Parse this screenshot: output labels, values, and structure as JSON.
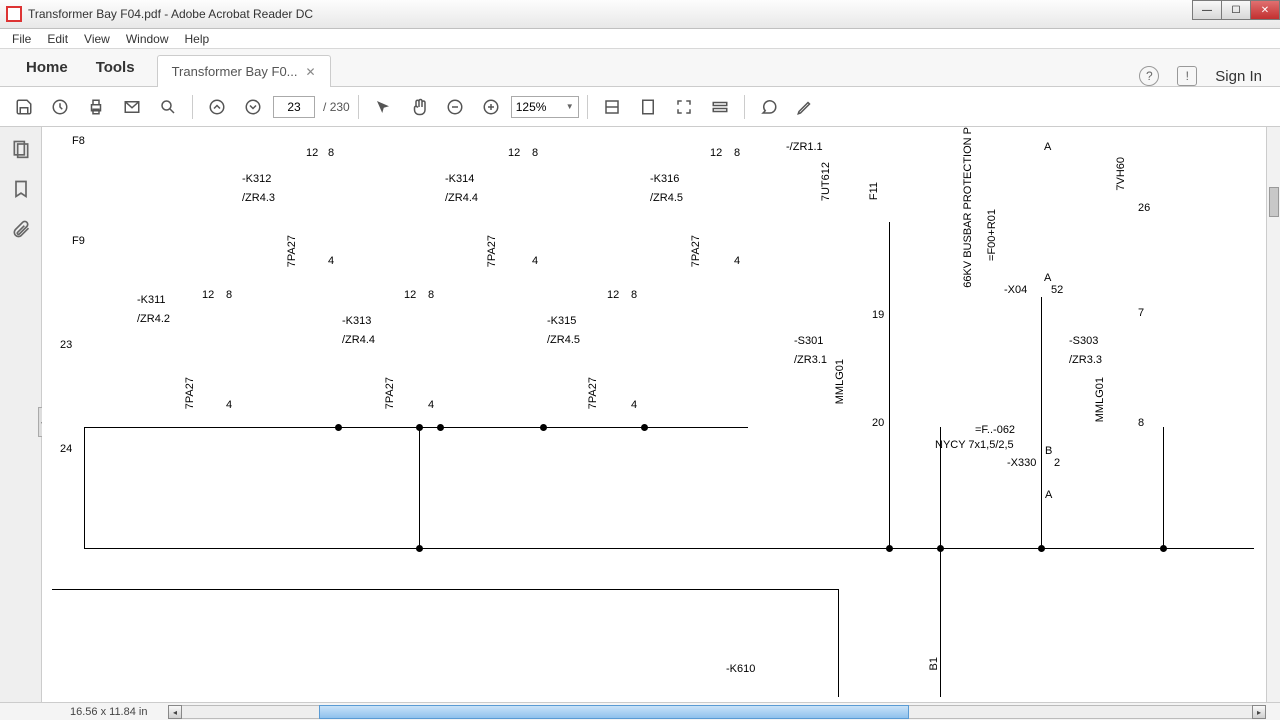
{
  "window": {
    "title": "Transformer Bay F04.pdf - Adobe Acrobat Reader DC"
  },
  "menu": {
    "file": "File",
    "edit": "Edit",
    "view": "View",
    "window": "Window",
    "help": "Help"
  },
  "tabs": {
    "home": "Home",
    "tools": "Tools",
    "file_label": "Transformer Bay F0...",
    "signin": "Sign In"
  },
  "toolbar": {
    "page_current": "23",
    "page_sep": "/",
    "page_total": "230",
    "zoom": "125%"
  },
  "status": {
    "dimensions": "16.56 x 11.84 in"
  },
  "labels": {
    "F8": "F8",
    "F9": "F9",
    "z23": "23",
    "z24": "24",
    "K311": "-K311",
    "ZR42a": "/ZR4.2",
    "K312": "-K312",
    "ZR43": "/ZR4.3",
    "K313": "-K313",
    "ZR44a": "/ZR4.4",
    "K314": "-K314",
    "ZR44b": "/ZR4.4",
    "K315": "-K315",
    "ZR45a": "/ZR4.5",
    "K316": "-K316",
    "ZR45b": "/ZR4.5",
    "ZR11": "-/ZR1.1",
    "S301": "-S301",
    "ZR31": "/ZR3.1",
    "S303": "-S303",
    "ZR33": "/ZR3.3",
    "ut612": "7UT612",
    "F11": "F11",
    "busbar": "66KV BUSBAR PROTECTION P",
    "F00": "=F00+R01",
    "X04": "-X04",
    "n52": "52",
    "vh60": "7VH60",
    "n26": "26",
    "F062": "=F..-062",
    "NYCY": "NYCY 7x1,5/2,5",
    "X330": "-X330",
    "A1": "A",
    "B1": "B",
    "n2": "2",
    "A2": "A",
    "pa27": "7PA27",
    "mmlg": "MMLG01",
    "n12": "12",
    "n8": "8",
    "n4": "4",
    "n7": "7",
    "n19": "19",
    "n20": "20",
    "K610": "-K610",
    "B1v": "B1"
  }
}
